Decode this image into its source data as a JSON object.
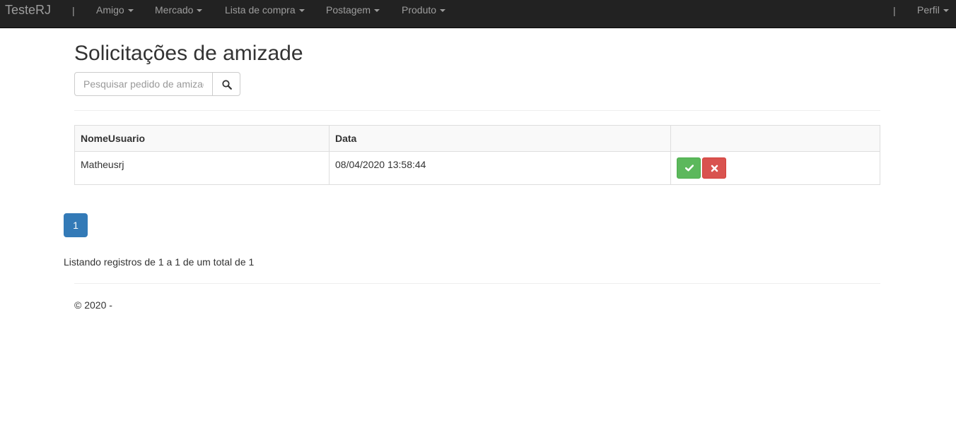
{
  "navbar": {
    "brand": "TesteRJ",
    "separator": "|",
    "menus": [
      {
        "label": "Amigo"
      },
      {
        "label": "Mercado"
      },
      {
        "label": "Lista de compra"
      },
      {
        "label": "Postagem"
      },
      {
        "label": "Produto"
      }
    ],
    "profile": {
      "label": "Perfil"
    }
  },
  "page": {
    "title": "Solicitações de amizade"
  },
  "search": {
    "placeholder": "Pesquisar pedido de amizade",
    "button_icon": "search-icon"
  },
  "table": {
    "headers": [
      "NomeUsuario",
      "Data",
      ""
    ],
    "rows": [
      {
        "nome_usuario": "Matheusrj",
        "data": "08/04/2020 13:58:44",
        "accept_icon": "check-icon",
        "reject_icon": "close-icon"
      }
    ]
  },
  "pagination": {
    "current": "1"
  },
  "listing": {
    "text": "Listando registros de 1 a 1 de um total de 1"
  },
  "footer": {
    "text": "© 2020 -"
  },
  "colors": {
    "navbar_bg": "#222222",
    "nav_text": "#9d9d9d",
    "primary": "#337ab7",
    "success": "#5cb85c",
    "danger": "#d9534f"
  }
}
